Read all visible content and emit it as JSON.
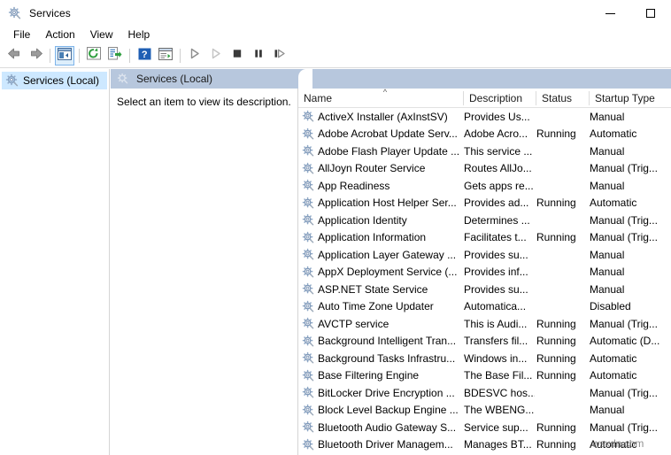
{
  "window": {
    "title": "Services",
    "icon": "services-gear-icon",
    "buttons": {
      "minimize": "minimize-icon",
      "maximize": "maximize-icon"
    }
  },
  "menubar": {
    "items": [
      {
        "label": "File"
      },
      {
        "label": "Action"
      },
      {
        "label": "View"
      },
      {
        "label": "Help"
      }
    ]
  },
  "toolbar": {
    "buttons": [
      {
        "name": "back-icon",
        "enabled": true
      },
      {
        "name": "forward-icon",
        "enabled": true
      },
      {
        "name": "show-hide-console-tree-icon",
        "enabled": true,
        "pressed": true
      },
      {
        "name": "refresh-icon",
        "enabled": true
      },
      {
        "name": "export-list-icon",
        "enabled": true
      },
      {
        "name": "help-icon",
        "enabled": true
      },
      {
        "name": "properties-icon",
        "enabled": true
      },
      {
        "name": "start-service-icon",
        "enabled": true
      },
      {
        "name": "resume-service-icon",
        "enabled": false
      },
      {
        "name": "stop-service-icon",
        "enabled": true
      },
      {
        "name": "pause-service-icon",
        "enabled": true
      },
      {
        "name": "restart-service-icon",
        "enabled": true
      }
    ]
  },
  "tree": {
    "items": [
      {
        "label": "Services (Local)",
        "icon": "services-gear-icon",
        "selected": true
      }
    ]
  },
  "detail": {
    "header_title": "Services (Local)",
    "header_icon": "services-gear-icon",
    "body_text": "Select an item to view its description."
  },
  "list": {
    "columns": [
      {
        "key": "name",
        "label": "Name",
        "sorted": "asc"
      },
      {
        "key": "description",
        "label": "Description"
      },
      {
        "key": "status",
        "label": "Status"
      },
      {
        "key": "startup",
        "label": "Startup Type"
      }
    ],
    "rows": [
      {
        "name": "ActiveX Installer (AxInstSV)",
        "description": "Provides Us...",
        "status": "",
        "startup": "Manual"
      },
      {
        "name": "Adobe Acrobat Update Serv...",
        "description": "Adobe Acro...",
        "status": "Running",
        "startup": "Automatic"
      },
      {
        "name": "Adobe Flash Player Update ...",
        "description": "This service ...",
        "status": "",
        "startup": "Manual"
      },
      {
        "name": "AllJoyn Router Service",
        "description": "Routes AllJo...",
        "status": "",
        "startup": "Manual (Trig..."
      },
      {
        "name": "App Readiness",
        "description": "Gets apps re...",
        "status": "",
        "startup": "Manual"
      },
      {
        "name": "Application Host Helper Ser...",
        "description": "Provides ad...",
        "status": "Running",
        "startup": "Automatic"
      },
      {
        "name": "Application Identity",
        "description": "Determines ...",
        "status": "",
        "startup": "Manual (Trig..."
      },
      {
        "name": "Application Information",
        "description": "Facilitates t...",
        "status": "Running",
        "startup": "Manual (Trig..."
      },
      {
        "name": "Application Layer Gateway ...",
        "description": "Provides su...",
        "status": "",
        "startup": "Manual"
      },
      {
        "name": "AppX Deployment Service (...",
        "description": "Provides inf...",
        "status": "",
        "startup": "Manual"
      },
      {
        "name": "ASP.NET State Service",
        "description": "Provides su...",
        "status": "",
        "startup": "Manual"
      },
      {
        "name": "Auto Time Zone Updater",
        "description": "Automatica...",
        "status": "",
        "startup": "Disabled"
      },
      {
        "name": "AVCTP service",
        "description": "This is Audi...",
        "status": "Running",
        "startup": "Manual (Trig..."
      },
      {
        "name": "Background Intelligent Tran...",
        "description": "Transfers fil...",
        "status": "Running",
        "startup": "Automatic (D..."
      },
      {
        "name": "Background Tasks Infrastru...",
        "description": "Windows in...",
        "status": "Running",
        "startup": "Automatic"
      },
      {
        "name": "Base Filtering Engine",
        "description": "The Base Fil...",
        "status": "Running",
        "startup": "Automatic"
      },
      {
        "name": "BitLocker Drive Encryption ...",
        "description": "BDESVC hos...",
        "status": "",
        "startup": "Manual (Trig..."
      },
      {
        "name": "Block Level Backup Engine ...",
        "description": "The WBENG...",
        "status": "",
        "startup": "Manual"
      },
      {
        "name": "Bluetooth Audio Gateway S...",
        "description": "Service sup...",
        "status": "Running",
        "startup": "Manual (Trig..."
      },
      {
        "name": "Bluetooth Driver Managem...",
        "description": "Manages BT...",
        "status": "Running",
        "startup": "Automatic"
      }
    ]
  },
  "watermark": {
    "text": "wsxdn.com"
  },
  "colors": {
    "header_bar": "#b7c7dd",
    "tree_selection": "#cde8ff",
    "toolbar_pressed": "#ddeefb"
  }
}
